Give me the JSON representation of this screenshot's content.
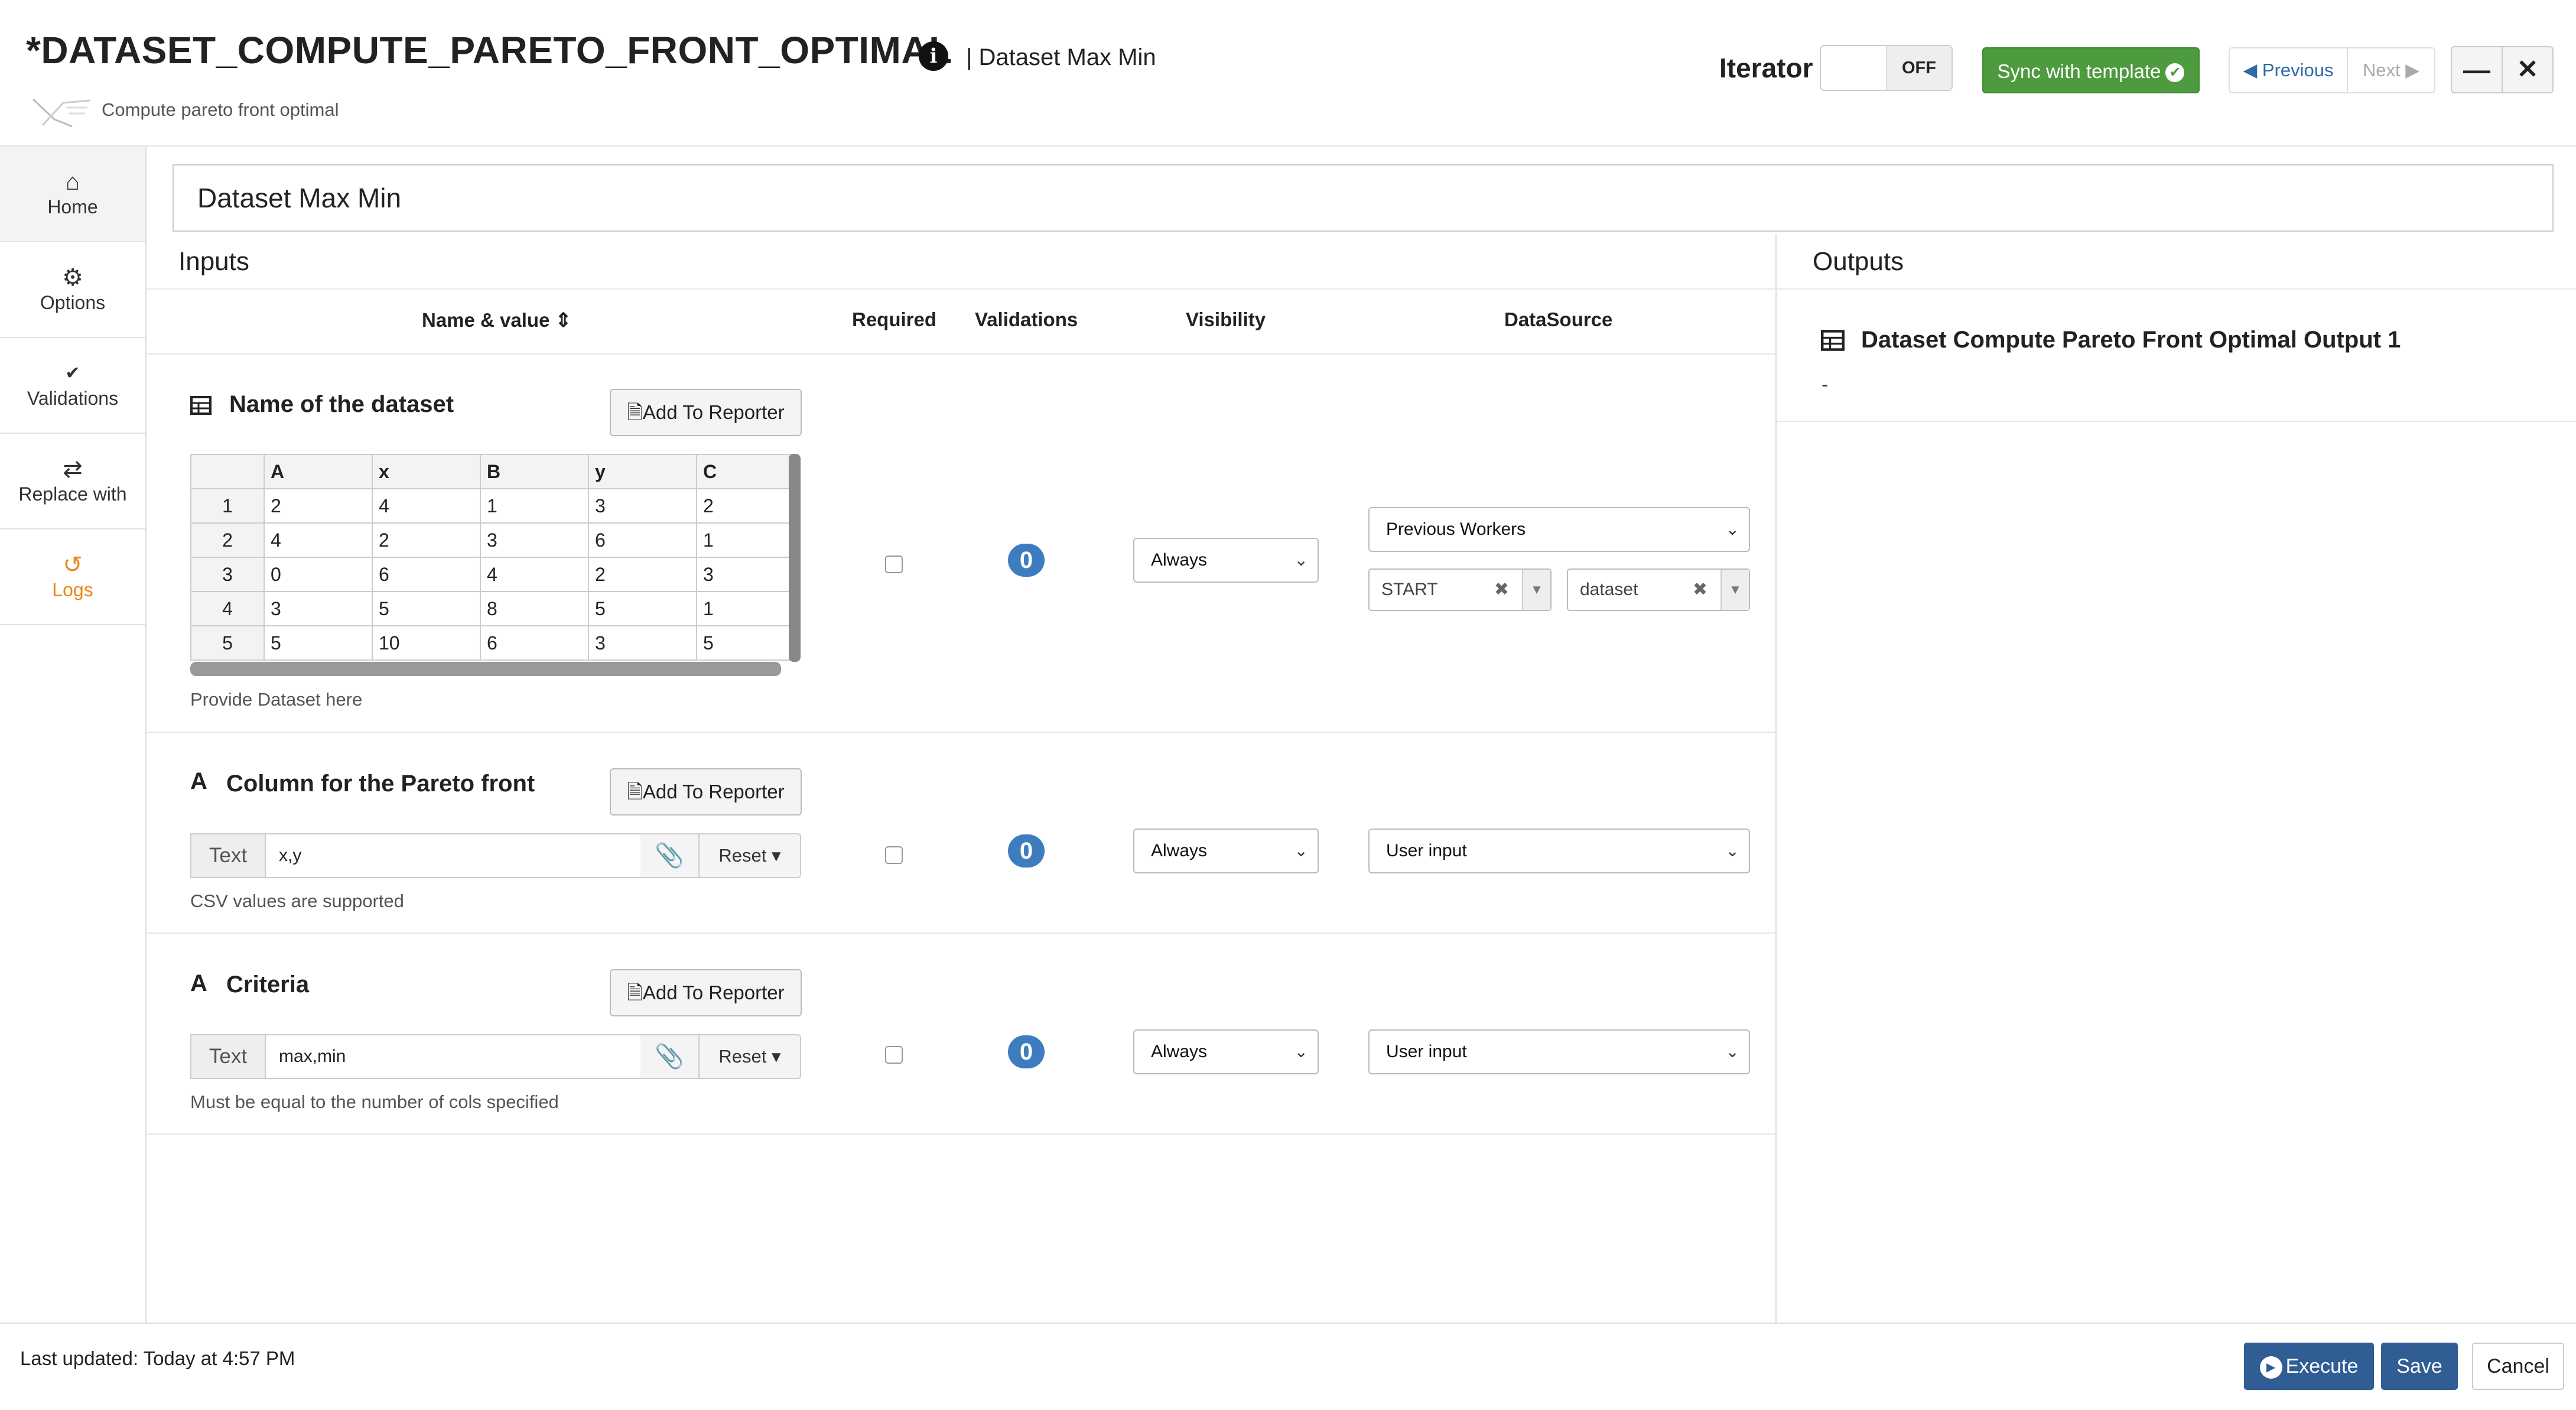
{
  "header": {
    "title": "*DATASET_COMPUTE_PARETO_FRONT_OPTIMAL",
    "subtitle": "| Dataset Max Min",
    "description": "Compute pareto front optimal",
    "iterator_label": "Iterator",
    "iterator_state": "OFF",
    "sync_label": "Sync with template",
    "previous_label": "Previous",
    "next_label": "Next"
  },
  "sidebar": {
    "items": [
      {
        "label": "Home",
        "icon": "home-icon"
      },
      {
        "label": "Options",
        "icon": "gear-icon"
      },
      {
        "label": "Validations",
        "icon": "double-check-icon"
      },
      {
        "label": "Replace with",
        "icon": "swap-arrows-icon"
      },
      {
        "label": "Logs",
        "icon": "history-icon"
      }
    ]
  },
  "main": {
    "name_value": "Dataset Max Min",
    "inputs_title": "Inputs",
    "outputs_title": "Outputs",
    "columns": {
      "name_value": "Name & value",
      "required": "Required",
      "validations": "Validations",
      "visibility": "Visibility",
      "datasource": "DataSource"
    },
    "reporter_label": "Add To Reporter",
    "inputs": [
      {
        "title": "Name of the dataset",
        "hint": "Provide Dataset here",
        "validations_count": "0",
        "visibility": "Always",
        "datasource": "Previous Workers",
        "source_worker": "START",
        "source_output": "dataset",
        "table": {
          "headers": [
            "A",
            "x",
            "B",
            "y",
            "C"
          ],
          "rows": [
            {
              "n": "1",
              "cells": [
                "2",
                "4",
                "1",
                "3",
                "2"
              ]
            },
            {
              "n": "2",
              "cells": [
                "4",
                "2",
                "3",
                "6",
                "1"
              ]
            },
            {
              "n": "3",
              "cells": [
                "0",
                "6",
                "4",
                "2",
                "3"
              ]
            },
            {
              "n": "4",
              "cells": [
                "3",
                "5",
                "8",
                "5",
                "1"
              ]
            },
            {
              "n": "5",
              "cells": [
                "5",
                "10",
                "6",
                "3",
                "5"
              ]
            }
          ]
        }
      },
      {
        "title": "Column for the Pareto front",
        "type_label": "Text",
        "value": "x,y",
        "reset_label": "Reset",
        "hint": "CSV values are supported",
        "validations_count": "0",
        "visibility": "Always",
        "datasource": "User input"
      },
      {
        "title": "Criteria",
        "type_label": "Text",
        "value": "max,min",
        "reset_label": "Reset",
        "hint": "Must be equal to the number of cols specified",
        "validations_count": "0",
        "visibility": "Always",
        "datasource": "User input"
      }
    ],
    "output": {
      "title": "Dataset Compute Pareto Front Optimal Output 1",
      "value": "-"
    }
  },
  "footer": {
    "last_updated": "Last updated: Today at 4:57 PM",
    "execute_label": "Execute",
    "save_label": "Save",
    "cancel_label": "Cancel"
  },
  "colors": {
    "sync_green": "#4e9a3e",
    "primary_blue": "#2f5d94",
    "badge_blue": "#3d7dbf",
    "logs_orange": "#e8891a"
  }
}
